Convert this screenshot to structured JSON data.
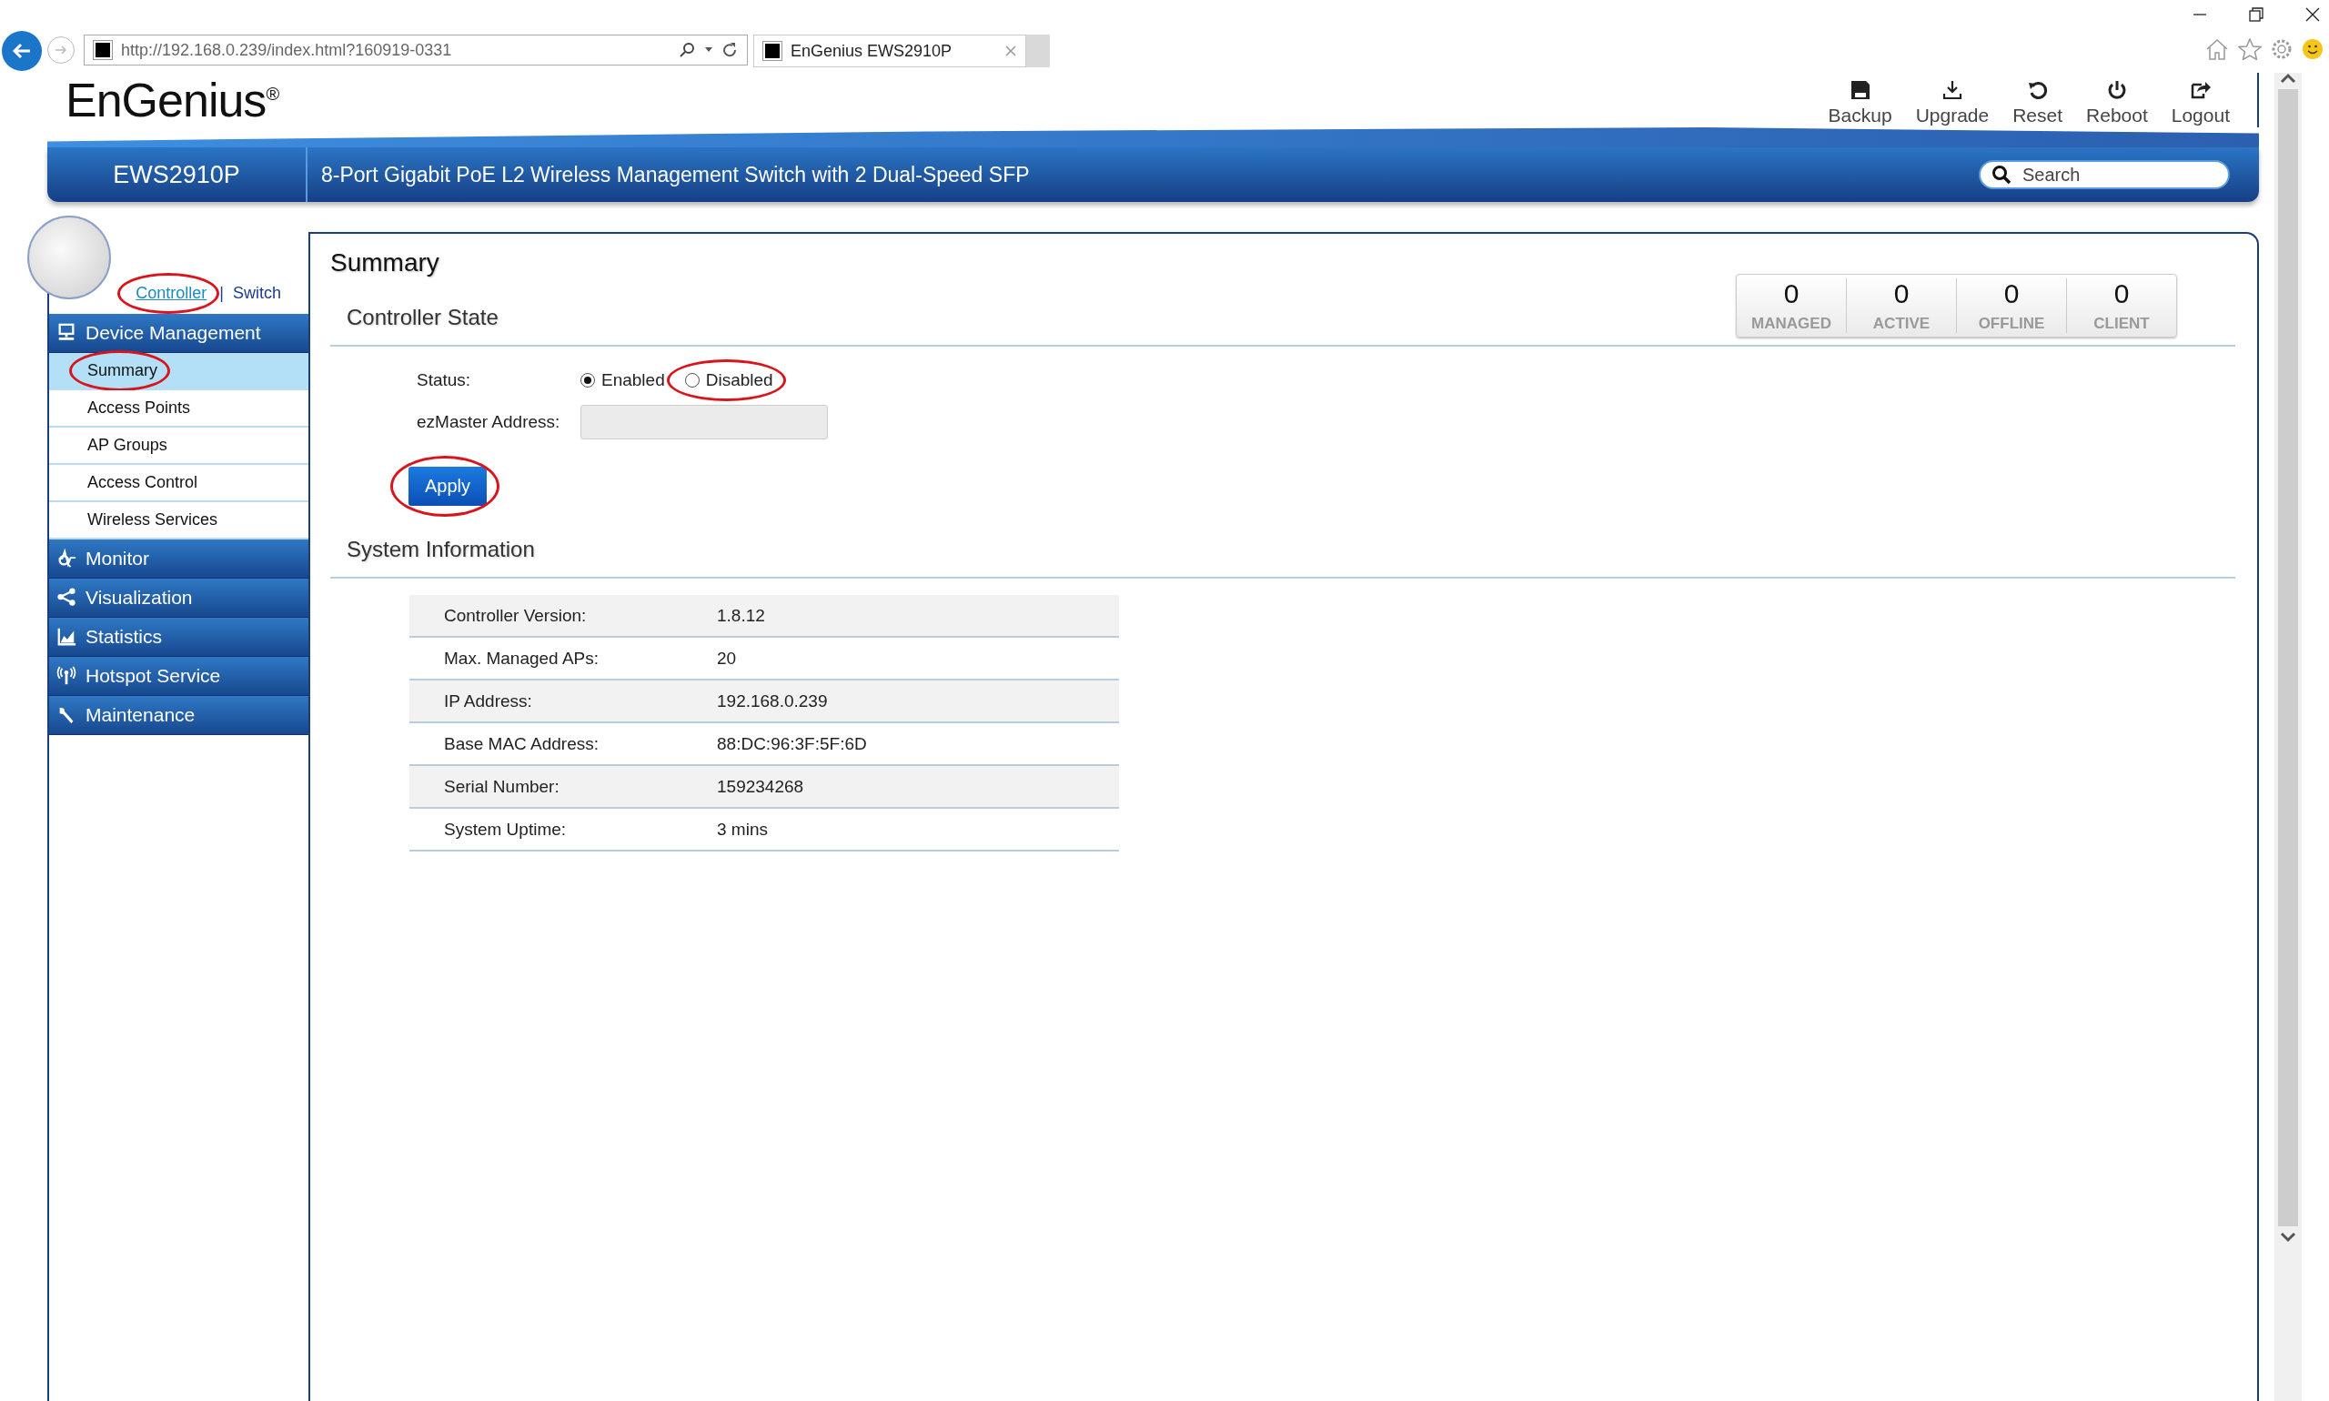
{
  "browser": {
    "url": "http://192.168.0.239/index.html?160919-0331",
    "tab_title": "EnGenius EWS2910P"
  },
  "header": {
    "logo": "EnGenius",
    "logo_mark": "®",
    "model": "EWS2910P",
    "description": "8-Port Gigabit PoE L2 Wireless Management Switch with 2 Dual-Speed SFP",
    "search": {
      "placeholder": "Search"
    },
    "toolbar": [
      {
        "label": "Backup"
      },
      {
        "label": "Upgrade"
      },
      {
        "label": "Reset"
      },
      {
        "label": "Reboot"
      },
      {
        "label": "Logout"
      }
    ]
  },
  "mode_separator": "|",
  "mode_switch": [
    {
      "label": "Controller",
      "selected": true,
      "circled": true
    },
    {
      "label": "Switch",
      "selected": false,
      "circled": false
    }
  ],
  "sidebar": [
    {
      "label": "Device Management",
      "children": [
        {
          "label": "Summary",
          "selected": true,
          "circled": true
        },
        {
          "label": "Access Points",
          "selected": false,
          "circled": false
        },
        {
          "label": "AP Groups",
          "selected": false,
          "circled": false
        },
        {
          "label": "Access Control",
          "selected": false,
          "circled": false
        },
        {
          "label": "Wireless Services",
          "selected": false,
          "circled": false
        }
      ]
    },
    {
      "label": "Monitor"
    },
    {
      "label": "Visualization"
    },
    {
      "label": "Statistics"
    },
    {
      "label": "Hotspot Service"
    },
    {
      "label": "Maintenance"
    }
  ],
  "page_title": "Summary",
  "stats": [
    {
      "value": "0",
      "label": "MANAGED"
    },
    {
      "value": "0",
      "label": "ACTIVE"
    },
    {
      "value": "0",
      "label": "OFFLINE"
    },
    {
      "value": "0",
      "label": "CLIENT"
    }
  ],
  "controller_state": {
    "heading": "Controller State",
    "status_label": "Status:",
    "status_options": [
      {
        "label": "Enabled",
        "selected": true,
        "circled": false
      },
      {
        "label": "Disabled",
        "selected": false,
        "circled": true
      }
    ],
    "address_label": "ezMaster Address:",
    "apply": {
      "label": "Apply",
      "circled": true
    }
  },
  "system_information": {
    "heading": "System Information",
    "rows": [
      {
        "label": "Controller Version:",
        "value": "1.8.12"
      },
      {
        "label": "Max. Managed APs:",
        "value": "20"
      },
      {
        "label": "IP Address:",
        "value": "192.168.0.239"
      },
      {
        "label": "Base MAC Address:",
        "value": "88:DC:96:3F:5F:6D"
      },
      {
        "label": "Serial Number:",
        "value": "159234268"
      },
      {
        "label": "System Uptime:",
        "value": "3 mins"
      }
    ]
  }
}
